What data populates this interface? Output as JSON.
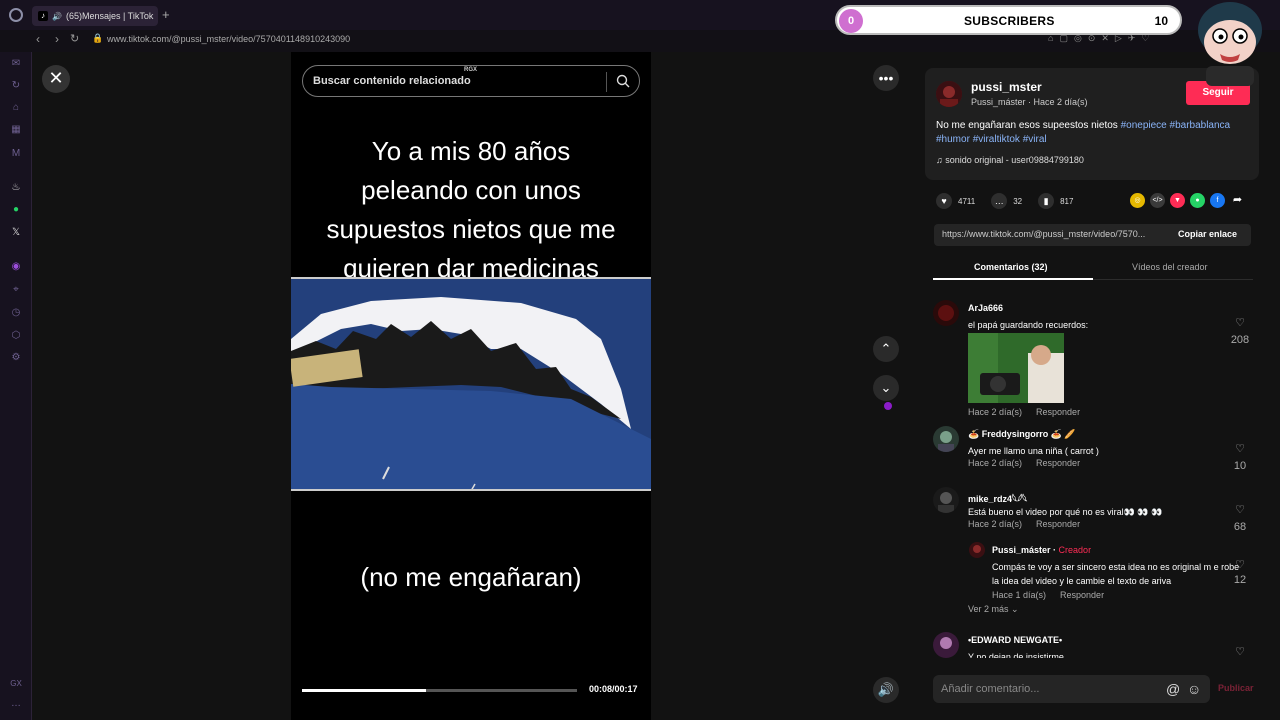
{
  "browser": {
    "tab_title": "(65)Mensajes | TikTok",
    "url": "www.tiktok.com/@pussi_mster/video/7570401148910243090"
  },
  "overlay": {
    "subscribers_label": "SUBSCRIBERS",
    "count_left": "0",
    "count_right": "10"
  },
  "video": {
    "search_placeholder": "Buscar contenido relacionado",
    "watermark": "RGX",
    "caption_top": "Yo a mis 80 años\npeleando con unos\nsupuestos nietos que me\nquieren dar medicinas",
    "caption_bottom": "(no me engañaran)",
    "time": "00:08/00:17",
    "progress": 0.45
  },
  "post": {
    "author": "pussi_mster",
    "author_sub": "Pussi_máster · Hace 2 día(s)",
    "follow_label": "Seguir",
    "description": "No me engañaran esos supeestos nietos",
    "hashtags": [
      "#onepiece",
      "#barbablanca",
      "#humor",
      "#viraltiktok",
      "#viral"
    ],
    "music": "sonido original - user09884799180",
    "likes": "4711",
    "comments": "32",
    "saves": "817",
    "share_link": "https://www.tiktok.com/@pussi_mster/video/7570...",
    "copy_label": "Copiar enlace"
  },
  "tabs": {
    "comments": "Comentarios (32)",
    "creator_videos": "Vídeos del creador"
  },
  "comment_list": [
    {
      "name": "ArJa666",
      "text": "el papá guardando recuerdos:",
      "time": "Hace 2 día(s)",
      "reply": "Responder",
      "likes": "208"
    },
    {
      "name": "🍝 Freddysingorro 🍝 🥖",
      "text": "Ayer me llamo una niña ( carrot )",
      "time": "Hace 2 día(s)",
      "reply": "Responder",
      "likes": "10"
    },
    {
      "name": "mike_rdz4𓆩𓆪𓆩",
      "text": "Está bueno el video por qué no es viral👀 👀 👀",
      "time": "Hace 2 día(s)",
      "reply": "Responder",
      "likes": "68"
    },
    {
      "name": "•EDWARD NEWGATE•",
      "text": "Y no dejan de insistirme..."
    }
  ],
  "reply": {
    "name": "Pussi_máster",
    "tag": "Creador",
    "text": "Compás te voy a ser sincero esta idea no es original m e robe la idea del video y le cambie el texto de ariva",
    "time": "Hace 1 día(s)",
    "reply": "Responder",
    "likes": "12",
    "more": "Ver 2 más"
  },
  "composer": {
    "placeholder": "Añadir comentario...",
    "publish": "Publicar"
  }
}
